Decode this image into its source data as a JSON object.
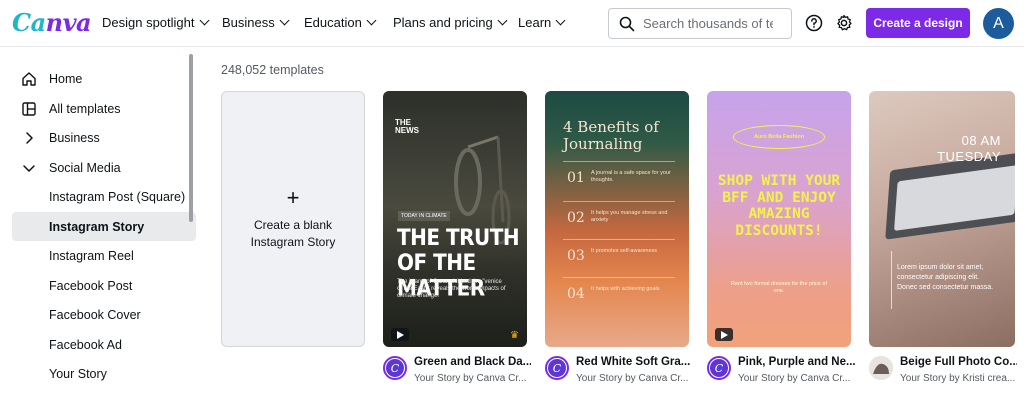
{
  "brand": {
    "logo_left": "Ca",
    "logo_right": "nva"
  },
  "nav": {
    "items": [
      {
        "label": "Design spotlight"
      },
      {
        "label": "Business"
      },
      {
        "label": "Education"
      },
      {
        "label": "Plans and pricing"
      },
      {
        "label": "Learn"
      }
    ],
    "search_placeholder": "Search thousands of te",
    "create_label": "Create a design",
    "avatar_letter": "A"
  },
  "sidebar": {
    "items": [
      {
        "label": "Home"
      },
      {
        "label": "All templates"
      },
      {
        "label": "Business"
      },
      {
        "label": "Social Media"
      },
      {
        "label": "Instagram Post (Square)"
      },
      {
        "label": "Instagram Story"
      },
      {
        "label": "Instagram Reel"
      },
      {
        "label": "Facebook Post"
      },
      {
        "label": "Facebook Cover"
      },
      {
        "label": "Facebook Ad"
      },
      {
        "label": "Your Story"
      }
    ]
  },
  "main": {
    "count_text": "248,052 templates",
    "blank_plus": "+",
    "blank_label": "Create a blank Instagram Story",
    "templates": [
      {
        "title": "Green and Black Da...",
        "subtitle": "Your Story by Canva Cr...",
        "content": {
          "news": "THE NEWS",
          "tag": "TODAY IN CLIMATE",
          "headline": "THE TRUTH OF THE MATTER",
          "body": "The island of Oaxa, dubbed the \"venice of the East,\" reveals the worst impacts of climate change."
        }
      },
      {
        "title": "Red White Soft Gra...",
        "subtitle": "Your Story by Canva Cr...",
        "content": {
          "heading": "4 Benefits of Journaling",
          "rows": [
            {
              "num": "01",
              "text": "A journal is a safe space for your thoughts."
            },
            {
              "num": "02",
              "text": "It helps you manage stress and anxiety"
            },
            {
              "num": "03",
              "text": "It promotes self-awareness"
            },
            {
              "num": "04",
              "text": "It helps with achieving goals"
            }
          ]
        }
      },
      {
        "title": "Pink, Purple and Ne...",
        "subtitle": "Your Story by Canva Cr...",
        "content": {
          "oval": "Auro Bella Fashion",
          "big": "SHOP WITH YOUR BFF AND ENJOY AMAZING DISCOUNTS!",
          "small": "Rent two formal dresses for the price of one."
        }
      },
      {
        "title": "Beige Full Photo Co...",
        "subtitle": "Your Story by Kristi crea...",
        "content": {
          "time": "08 AM",
          "day": "TUESDAY",
          "para": "Lorem ipsum dolor sit amet, consectetur adipiscing elit. Donec sed consectetur massa."
        }
      }
    ]
  },
  "colors": {
    "accent": "#7d2ae8",
    "logo_teal": "#20b6c9",
    "avatar": "#1c5c9c"
  }
}
